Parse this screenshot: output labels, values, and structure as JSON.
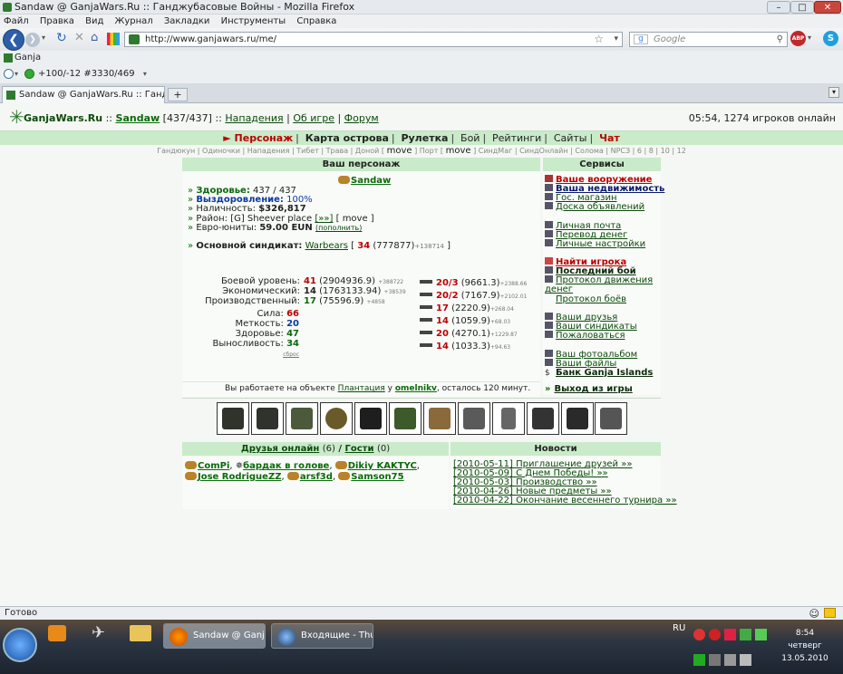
{
  "window": {
    "title": "Sandaw @ GanjaWars.Ru :: Ганджубасовые Войны - Mozilla Firefox"
  },
  "menu": [
    "Файл",
    "Правка",
    "Вид",
    "Журнал",
    "Закладки",
    "Инструменты",
    "Справка"
  ],
  "nav": {
    "url": "http://www.ganjawars.ru/me/",
    "search_placeholder": "Google"
  },
  "bookmarks": {
    "item": "Ganja"
  },
  "toolbar3": {
    "text": "+100/-12  #3330/469"
  },
  "tab": {
    "title": "Sandaw @ GanjaWars.Ru :: Ганджуба...",
    "new": "+"
  },
  "site": {
    "brand": "GanjaWars.Ru",
    "sep": "::",
    "user": "Sandaw",
    "hp": "[437/437]",
    "attacks": "Нападения",
    "about": "Об игре",
    "forum": "Форум",
    "clock": "05:54, 1274 игроков онлайн",
    "mainnav": [
      "Персонаж",
      "Карта острова",
      "Рулетка",
      "Бой",
      "Рейтинги",
      "Сайты",
      "Чат"
    ],
    "subnav_a": "Гандюкун | Одиночки | Нападения | Тибет | Трава | Доной [",
    "subnav_move1": "move",
    "subnav_b": "] Порт [",
    "subnav_move2": "move",
    "subnav_c": "] СиндМаг | СиндОнлайн | Солома | NPCЗ | 6 | 8 | 10 | 12"
  },
  "char": {
    "header": "Ваш персонаж",
    "name": "Sandaw",
    "health_label": "Здоровье:",
    "health": "437 / 437",
    "regen_label": "Выздоровление:",
    "regen": "100%",
    "cash_label": "Наличность:",
    "cash": "$326,817",
    "district_label": "Район:",
    "district": "[G] Sheever place",
    "district_link": "[»»]",
    "district_move": "[ move ]",
    "euro_label": "Евро-юниты:",
    "euro": "59.00 EUN",
    "euro_link": "(пополнить)",
    "syndicate_label": "Основной синдикат:",
    "syndicate": "Warbears",
    "syndicate_lvl": "34",
    "syndicate_pts": "(777877)",
    "syndicate_inc": "+138714",
    "stats": [
      {
        "label": "Боевой уровень:",
        "lvl": "41",
        "val": "(2904936.9)",
        "inc": "+388722"
      },
      {
        "label": "Экономический:",
        "lvl": "14",
        "val": "(1763133.94)",
        "inc": "+38539"
      },
      {
        "label": "Производственный:",
        "lvl": "17",
        "val": "(75596.9)",
        "inc": "+4858"
      }
    ],
    "attrs": [
      {
        "label": "Сила:",
        "val": "66",
        "color": "#b00"
      },
      {
        "label": "Меткость:",
        "val": "20",
        "color": "#0a3aa0"
      },
      {
        "label": "Здоровье:",
        "val": "47",
        "color": "#0a6a0a"
      },
      {
        "label": "Выносливость:",
        "val": "34",
        "color": "#0a6a0a"
      }
    ],
    "reset": "сброс",
    "skills": [
      {
        "lvl": "20/3",
        "val": "(9661.3)",
        "inc": "+2388.66"
      },
      {
        "lvl": "20/2",
        "val": "(7167.9)",
        "inc": "+2102.01"
      },
      {
        "lvl": "17",
        "val": "(2220.9)",
        "inc": "+268.04"
      },
      {
        "lvl": "14",
        "val": "(1059.9)",
        "inc": "+68.03"
      },
      {
        "lvl": "20",
        "val": "(4270.1)",
        "inc": "+1229.87"
      },
      {
        "lvl": "14",
        "val": "(1033.3)",
        "inc": "+94.63"
      }
    ],
    "work_a": "Вы работаете на объекте",
    "work_obj": "Плантация",
    "work_b": "у",
    "work_owner": "omelnikv",
    "work_c": ", осталось 120 минут."
  },
  "services": {
    "header": "Сервисы",
    "items": [
      "Ваше вооружение",
      "Ваша недвижимость",
      "Гос. магазин",
      "Доска объявлений",
      "Личная почта",
      "Перевод денег",
      "Личные настройки",
      "Найти игрока",
      "Последний бой",
      "Протокол движения денег",
      "Протокол боёв",
      "Ваши друзья",
      "Ваши синдикаты",
      "Пожаловаться",
      "Ваш фотоальбом",
      "Ваши файлы",
      "Банк Ganja Islands"
    ],
    "exit": "Выход из игры"
  },
  "friends": {
    "header_friends": "Друзья онлайн",
    "friends_count": "(6)",
    "slash": "/",
    "header_guests": "Гости",
    "guests_count": "(0)",
    "list": [
      "ComPi",
      "бардак в голове",
      "Dikiy KAKTYC",
      "Jose RodrigueZZ",
      "arsf3d",
      "Samson75"
    ]
  },
  "news": {
    "header": "Новости",
    "items": [
      "[2010-05-11] Приглашение друзей »»",
      "[2010-05-09] С Днем Победы! »»",
      "[2010-05-03] Производство »»",
      "[2010-04-26] Новые предметы »»",
      "[2010-04-22] Окончание весеннего турнира »»"
    ]
  },
  "status": {
    "text": "Готово"
  },
  "taskbar": {
    "task1": "Sandaw @ Ganja...",
    "task2": "Входящие - Thun...",
    "lang": "RU",
    "time": "8:54",
    "day": "четверг",
    "date": "13.05.2010"
  }
}
